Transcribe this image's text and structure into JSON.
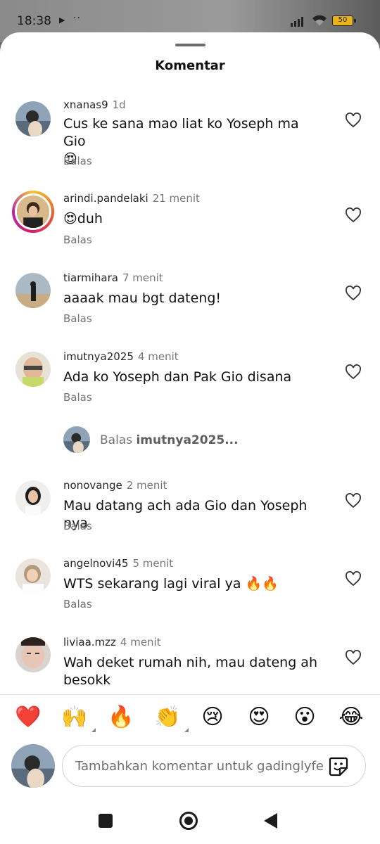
{
  "status_bar": {
    "time": "18:38",
    "battery": "50"
  },
  "sheet": {
    "title": "Komentar"
  },
  "comments": [
    {
      "username": "xnanas9",
      "time": "1d",
      "text": "Cus ke sana mao liat ko Yoseph ma Gio",
      "text2": "😍",
      "reply": "Balas"
    },
    {
      "username": "arindi.pandelaki",
      "time": "21 menit",
      "text": "😍duh",
      "reply": "Balas"
    },
    {
      "username": "tiarmihara",
      "time": "7 menit",
      "text": "aaaak mau bgt dateng!",
      "reply": "Balas"
    },
    {
      "username": "imutnya2025",
      "time": "4 menit",
      "text": "Ada ko Yoseph dan Pak Gio disana",
      "reply": "Balas"
    },
    {
      "username": "nonovange",
      "time": "2 menit",
      "text": "Mau datang ach ada Gio dan Yoseph nya",
      "reply": "Balas"
    },
    {
      "username": "angelnovi45",
      "time": "5 menit",
      "text": "WTS sekarang lagi viral ya 🔥🔥",
      "reply": "Balas"
    },
    {
      "username": "liviaa.mzz",
      "time": "4 menit",
      "text": "Wah deket rumah nih, mau dateng ah",
      "text2": "besokk"
    }
  ],
  "reply_prompt": {
    "prefix": "Balas ",
    "target": "imutnya2025..."
  },
  "emoji_bar": [
    "❤️",
    "🙌",
    "🔥",
    "👏",
    "😢",
    "😍",
    "😮",
    "😂"
  ],
  "composer": {
    "placeholder": "Tambahkan komentar untuk gadinglyfe",
    "value": ""
  }
}
